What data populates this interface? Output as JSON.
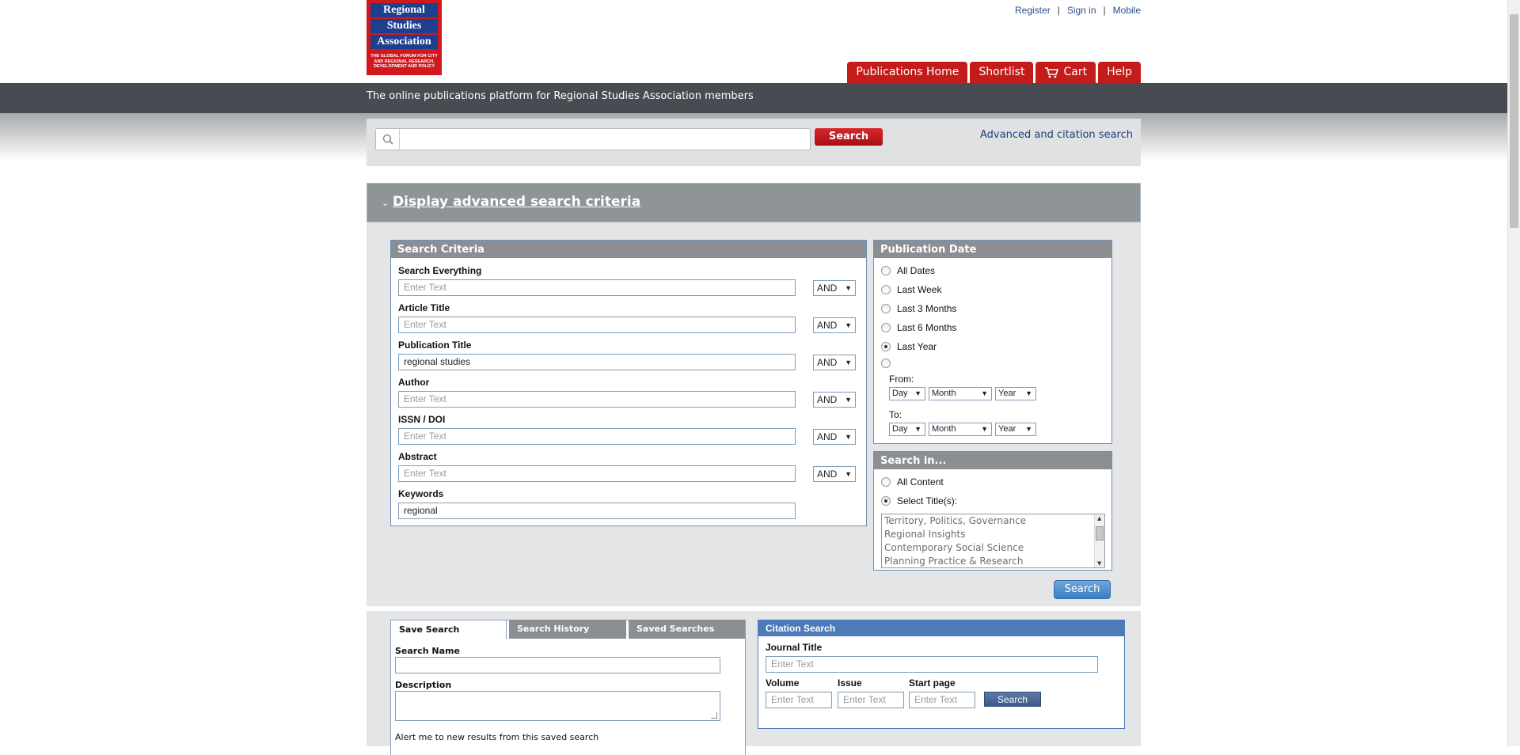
{
  "logo": {
    "line1": "Regional",
    "line2": "Studies",
    "line3": "Association",
    "tagline": "THE GLOBAL FORUM FOR CITY AND REGIONAL RESEARCH, DEVELOPMENT AND POLICY"
  },
  "toplinks": {
    "register": "Register",
    "signin": "Sign in",
    "mobile": "Mobile"
  },
  "nav": {
    "home": "Publications Home",
    "shortlist": "Shortlist",
    "cart": "Cart",
    "help": "Help"
  },
  "tagline": "The online publications platform for Regional Studies Association members",
  "quick_search": {
    "value": "",
    "button": "Search",
    "advanced_link": "Advanced and citation search"
  },
  "advanced": {
    "toggle": "Display advanced search criteria",
    "criteria": {
      "title": "Search Criteria",
      "placeholder": "Enter Text",
      "fields": [
        {
          "label": "Search Everything",
          "value": "",
          "op": "AND"
        },
        {
          "label": "Article Title",
          "value": "",
          "op": "AND"
        },
        {
          "label": "Publication Title",
          "value": "regional studies",
          "op": "AND"
        },
        {
          "label": "Author",
          "value": "",
          "op": "AND"
        },
        {
          "label": "ISSN / DOI",
          "value": "",
          "op": "AND"
        },
        {
          "label": "Abstract",
          "value": "",
          "op": "AND"
        },
        {
          "label": "Keywords",
          "value": "regional"
        }
      ]
    },
    "pub_date": {
      "title": "Publication Date",
      "options": [
        "All Dates",
        "Last Week",
        "Last 3 Months",
        "Last 6 Months",
        "Last Year"
      ],
      "selected": "Last Year",
      "from_label": "From:",
      "to_label": "To:",
      "day": "Day",
      "month": "Month",
      "year": "Year"
    },
    "search_in": {
      "title": "Search in...",
      "all_content": "All Content",
      "select_titles": "Select Title(s):",
      "selected": "Select Title(s):",
      "titles": [
        "Territory, Politics, Governance",
        "Regional Insights",
        "Contemporary Social Science",
        "Planning Practice & Research"
      ]
    },
    "search_button": "Search"
  },
  "saved": {
    "tabs": [
      "Save Search",
      "Search History",
      "Saved Searches"
    ],
    "active_tab": "Save Search",
    "search_name_label": "Search Name",
    "description_label": "Description",
    "alert_text": "Alert me to new results from this saved search"
  },
  "citation": {
    "title": "Citation Search",
    "journal_label": "Journal Title",
    "volume_label": "Volume",
    "issue_label": "Issue",
    "start_page_label": "Start page",
    "placeholder": "Enter Text",
    "button": "Search"
  },
  "colors": {
    "brand_red": "#c41b1b",
    "brand_blue": "#1d3f8f",
    "header_band": "#474c52",
    "citation_blue": "#4d7ab8"
  }
}
